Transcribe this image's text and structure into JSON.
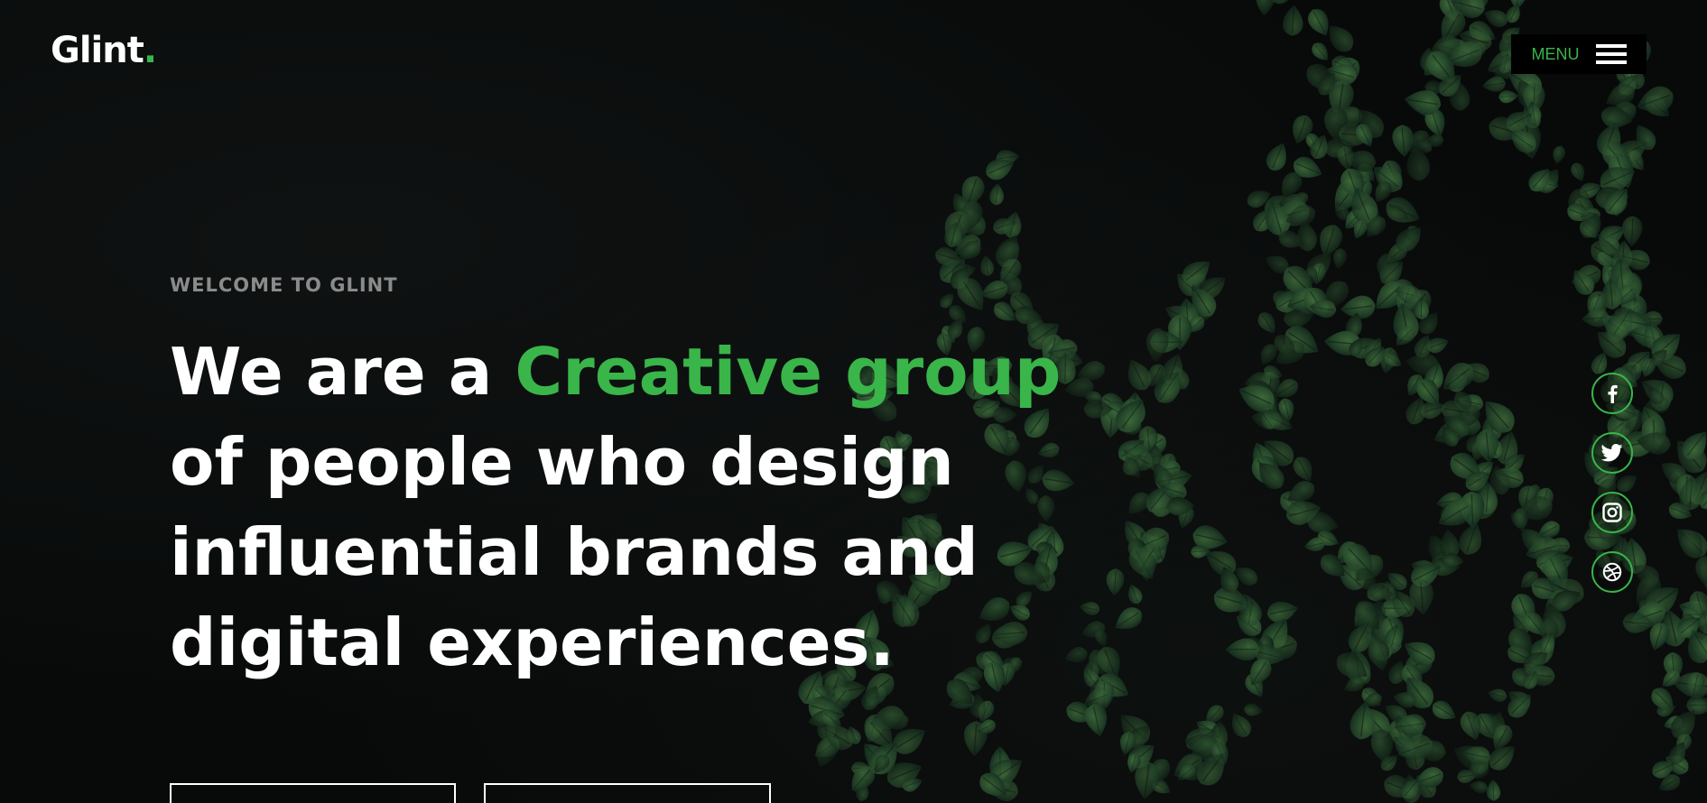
{
  "header": {
    "logo_text": "Glint",
    "logo_dot": ".",
    "menu_label": "MENU"
  },
  "hero": {
    "kicker": "WELCOME TO GLINT",
    "headline": {
      "part1": "We are a ",
      "accent": "Creative group",
      "line2": "of people who design",
      "line3": "influential brands and",
      "line4": "digital experiences."
    },
    "buttons": [
      {
        "label": ""
      },
      {
        "label": ""
      }
    ]
  },
  "social": [
    {
      "icon": "facebook-icon"
    },
    {
      "icon": "twitter-icon"
    },
    {
      "icon": "instagram-icon"
    },
    {
      "icon": "dribbble-icon"
    }
  ],
  "colors": {
    "accent": "#39b54a",
    "background": "#080a0a",
    "text": "#ffffff",
    "muted": "#8b8b8b"
  }
}
